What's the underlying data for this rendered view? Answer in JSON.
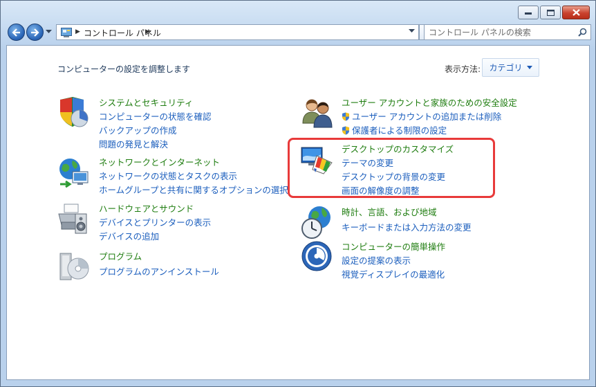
{
  "window": {
    "caption_buttons": [
      "minimize",
      "maximize",
      "close"
    ]
  },
  "address": {
    "crumb": "コントロール パネル",
    "search_placeholder": "コントロール パネルの検索"
  },
  "header": {
    "title": "コンピューターの設定を調整します",
    "view_by_label": "表示方法:",
    "view_by_value": "カテゴリ"
  },
  "left_categories": [
    {
      "title": "システムとセキュリティ",
      "icon": "shield-chart-icon",
      "links": [
        "コンピューターの状態を確認",
        "バックアップの作成",
        "問題の発見と解決"
      ]
    },
    {
      "title": "ネットワークとインターネット",
      "icon": "network-globe-icon",
      "links": [
        "ネットワークの状態とタスクの表示",
        "ホームグループと共有に関するオプションの選択"
      ]
    },
    {
      "title": "ハードウェアとサウンド",
      "icon": "printer-speaker-icon",
      "links": [
        "デバイスとプリンターの表示",
        "デバイスの追加"
      ]
    },
    {
      "title": "プログラム",
      "icon": "programs-disc-icon",
      "links": [
        "プログラムのアンインストール"
      ]
    }
  ],
  "right_categories": [
    {
      "title": "ユーザー アカウントと家族のための安全設定",
      "icon": "users-icon",
      "links": [
        "ユーザー アカウントの追加または削除",
        "保護者による制限の設定"
      ]
    },
    {
      "title": "デスクトップのカスタマイズ",
      "icon": "desktop-customize-icon",
      "links": [
        "テーマの変更",
        "デスクトップの背景の変更",
        "画面の解像度の調整"
      ]
    },
    {
      "title": "時計、言語、および地域",
      "icon": "globe-clock-icon",
      "links": [
        "キーボードまたは入力方法の変更"
      ]
    },
    {
      "title": "コンピューターの簡単操作",
      "icon": "ease-of-access-icon",
      "links": [
        "設定の提案の表示",
        "視覚ディスプレイの最適化"
      ]
    }
  ],
  "colors": {
    "category_title": "#1f7d10",
    "link": "#1b5ebd",
    "highlight": "#e83a3a"
  }
}
